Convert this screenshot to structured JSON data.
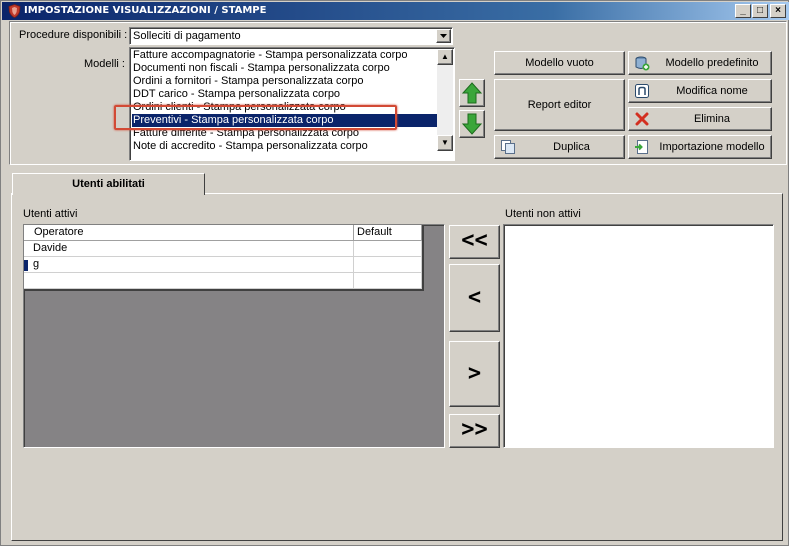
{
  "window": {
    "title": "IMPOSTAZIONE VISUALIZZAZIONI / STAMPE",
    "minimize": "_",
    "maximize": "□",
    "close": "×"
  },
  "procedure": {
    "label": "Procedure disponibili :",
    "value": "Solleciti di pagamento"
  },
  "modelli": {
    "label": "Modelli :",
    "items": [
      "Fatture accompagnatorie - Stampa personalizzata corpo",
      "Documenti non fiscali - Stampa personalizzata corpo",
      "Ordini a fornitori - Stampa personalizzata corpo",
      "DDT carico - Stampa personalizzata corpo",
      "Ordini clienti - Stampa personalizzata corpo",
      "Preventivi - Stampa personalizzata corpo",
      "Fatture differite - Stampa personalizzata corpo",
      "Note di accredito - Stampa personalizzata corpo"
    ],
    "selected_index": 5
  },
  "buttons": {
    "modello_vuoto": "Modello vuoto",
    "modello_predefinito": "Modello predefinito",
    "report_editor": "Report editor",
    "modifica_nome": "Modifica nome",
    "elimina": "Elimina",
    "duplica": "Duplica",
    "importazione_modello": "Importazione modello"
  },
  "tab": {
    "label": "Utenti abilitati"
  },
  "utenti_attivi": {
    "label": "Utenti attivi",
    "columns": [
      "Operatore",
      "Default"
    ],
    "rows": [
      [
        "Davide",
        ""
      ],
      [
        "g",
        ""
      ],
      [
        "",
        ""
      ]
    ]
  },
  "move_buttons": {
    "all_left": "<<",
    "left": "<",
    "right": ">",
    "all_right": ">>"
  },
  "utenti_non_attivi": {
    "label": "Utenti non attivi"
  },
  "colors": {
    "title_bar": "#0a246a",
    "selection": "#0a246a",
    "highlight_box": "#d24a35",
    "arrow_green": "#3aa63a",
    "grid_background": "#858385"
  },
  "icons": {
    "app": "shield-icon",
    "up": "green-up-arrow-icon",
    "down": "green-down-arrow-icon",
    "modello_predefinito": "database-add-icon",
    "modifica_nome": "rename-icon",
    "elimina": "red-x-icon",
    "duplica": "copy-icon",
    "importazione": "import-icon"
  }
}
